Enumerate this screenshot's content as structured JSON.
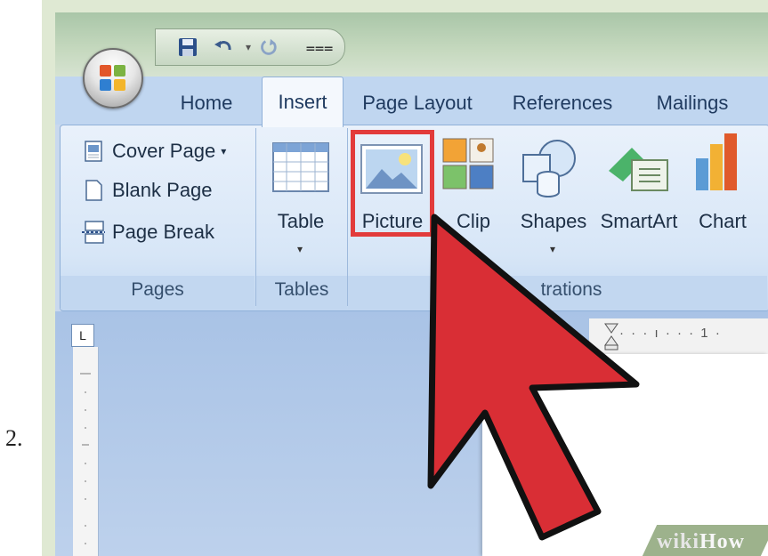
{
  "step_number": "2.",
  "quick_access": {
    "icons": [
      "save-icon",
      "undo-icon",
      "redo-icon",
      "customize-arrow-icon"
    ]
  },
  "tabs": [
    {
      "label": "Home",
      "active": false
    },
    {
      "label": "Insert",
      "active": true
    },
    {
      "label": "Page Layout",
      "active": false
    },
    {
      "label": "References",
      "active": false
    },
    {
      "label": "Mailings",
      "active": false
    }
  ],
  "ribbon": {
    "pages": {
      "items": [
        {
          "label": "Cover Page",
          "icon": "cover-page-icon",
          "has_dropdown": true
        },
        {
          "label": "Blank Page",
          "icon": "blank-page-icon"
        },
        {
          "label": "Page Break",
          "icon": "page-break-icon"
        }
      ],
      "group_label": "Pages"
    },
    "tables": {
      "label": "Table",
      "group_label": "Tables"
    },
    "illustrations": {
      "picture_label": "Picture",
      "clip_label": "Clip",
      "shapes_label": "Shapes",
      "smartart_label": "SmartArt",
      "chart_label": "Chart",
      "group_label": "trations"
    }
  },
  "ruler": {
    "tab_selector": "L",
    "marks": "· · · ı · · · 1 ·"
  },
  "watermark": {
    "part1": "wiki",
    "part2": "How"
  },
  "colors": {
    "highlight_box": "#e23b3b",
    "cursor_fill": "#d92e35",
    "ribbon_bg": "#d7e6f7",
    "tab_text": "#1f3a5f"
  }
}
